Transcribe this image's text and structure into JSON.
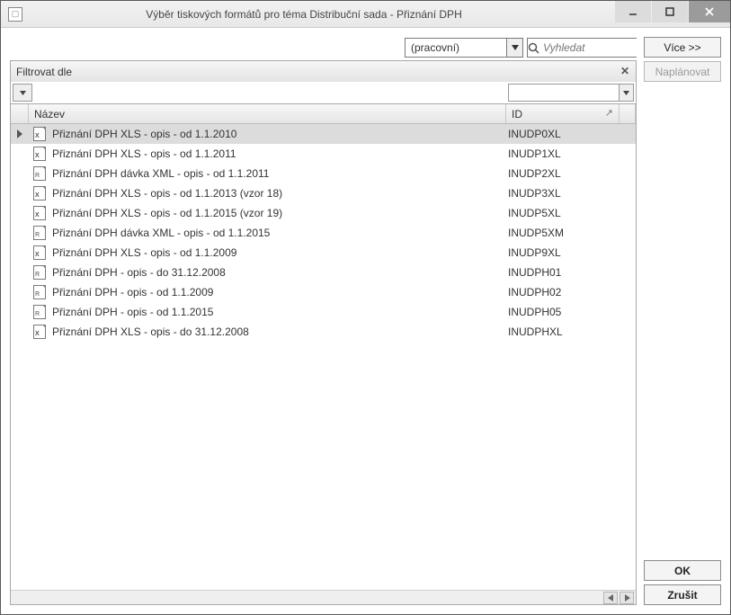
{
  "window": {
    "title": "Výběr tiskových formátů pro téma Distribuční sada - Přiznání DPH"
  },
  "toolbar": {
    "profile_combo": "(pracovní)",
    "search_placeholder": "Vyhledat"
  },
  "buttons": {
    "more": "Více >>",
    "schedule": "Naplánovat",
    "ok": "OK",
    "cancel": "Zrušit"
  },
  "filter": {
    "label": "Filtrovat dle"
  },
  "grid": {
    "columns": {
      "name": "Název",
      "id": "ID"
    },
    "rows": [
      {
        "icon": "xls",
        "name": "Přiznání DPH XLS - opis - od 1.1.2010",
        "id": "INUDP0XL",
        "selected": true
      },
      {
        "icon": "xls",
        "name": "Přiznání DPH XLS - opis - od 1.1.2011",
        "id": "INUDP1XL"
      },
      {
        "icon": "rpt",
        "name": "Přiznání DPH dávka XML - opis - od 1.1.2011",
        "id": "INUDP2XL"
      },
      {
        "icon": "xls",
        "name": "Přiznání DPH XLS - opis - od 1.1.2013 (vzor 18)",
        "id": "INUDP3XL"
      },
      {
        "icon": "xls",
        "name": "Přiznání DPH XLS - opis - od 1.1.2015 (vzor 19)",
        "id": "INUDP5XL"
      },
      {
        "icon": "rpt",
        "name": "Přiznání DPH dávka XML - opis - od 1.1.2015",
        "id": "INUDP5XM"
      },
      {
        "icon": "xls",
        "name": "Přiznání DPH XLS - opis - od 1.1.2009",
        "id": "INUDP9XL"
      },
      {
        "icon": "rpt",
        "name": "Přiznání DPH - opis - do 31.12.2008",
        "id": "INUDPH01"
      },
      {
        "icon": "rpt",
        "name": "Přiznání DPH - opis - od 1.1.2009",
        "id": "INUDPH02"
      },
      {
        "icon": "rpt",
        "name": "Přiznání DPH - opis - od 1.1.2015",
        "id": "INUDPH05"
      },
      {
        "icon": "xls",
        "name": "Přiznání DPH XLS - opis - do 31.12.2008",
        "id": "INUDPHXL"
      }
    ]
  }
}
